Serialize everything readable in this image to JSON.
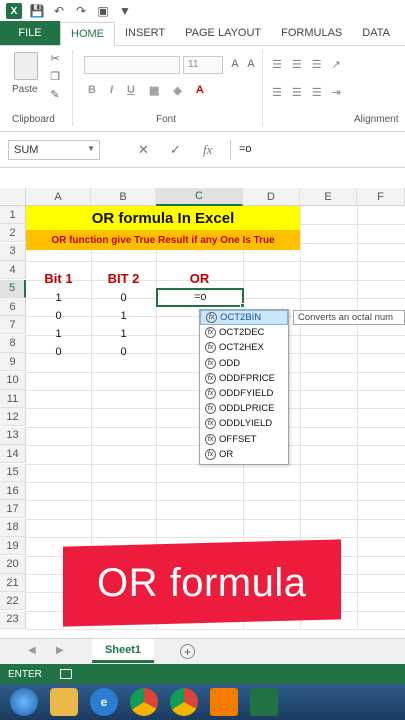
{
  "app": {
    "logo_text": "X"
  },
  "ribbon": {
    "tabs": [
      "FILE",
      "HOME",
      "INSERT",
      "PAGE LAYOUT",
      "FORMULAS",
      "DATA"
    ],
    "active_tab": "HOME",
    "paste_label": "Paste",
    "font_size": "11",
    "groups": [
      "Clipboard",
      "Font",
      "Alignment"
    ],
    "fmt_buttons": [
      "B",
      "I",
      "U"
    ]
  },
  "formula_bar": {
    "name_box": "SUM",
    "fx": "fx",
    "value": "=o"
  },
  "grid": {
    "columns": [
      "A",
      "B",
      "C",
      "D",
      "E",
      "F"
    ],
    "active_column": "C",
    "rows": [
      "1",
      "2",
      "3",
      "4",
      "5",
      "6",
      "7",
      "8",
      "9",
      "10",
      "11",
      "12",
      "13",
      "14",
      "15",
      "16",
      "17",
      "18",
      "19",
      "20",
      "21",
      "22",
      "23"
    ],
    "active_row": "5",
    "title": "OR  formula In Excel",
    "subtitle": "OR function give True Result if any One Is True",
    "headers": {
      "a": "Bit 1",
      "b": "BIT 2",
      "c": "OR"
    },
    "data": [
      {
        "a": "1",
        "b": "0"
      },
      {
        "a": "0",
        "b": "1"
      },
      {
        "a": "1",
        "b": "1"
      },
      {
        "a": "0",
        "b": "0"
      }
    ],
    "active_cell_value": "=o"
  },
  "autocomplete": {
    "items": [
      "OCT2BIN",
      "OCT2DEC",
      "OCT2HEX",
      "ODD",
      "ODDFPRICE",
      "ODDFYIELD",
      "ODDLPRICE",
      "ODDLYIELD",
      "OFFSET",
      "OR"
    ],
    "selected": "OCT2BIN",
    "tooltip": "Converts an octal num"
  },
  "banner": {
    "text": "OR formula"
  },
  "sheets": {
    "tabs": [
      "Sheet1"
    ],
    "add": "+"
  },
  "status": {
    "mode": "ENTER"
  }
}
